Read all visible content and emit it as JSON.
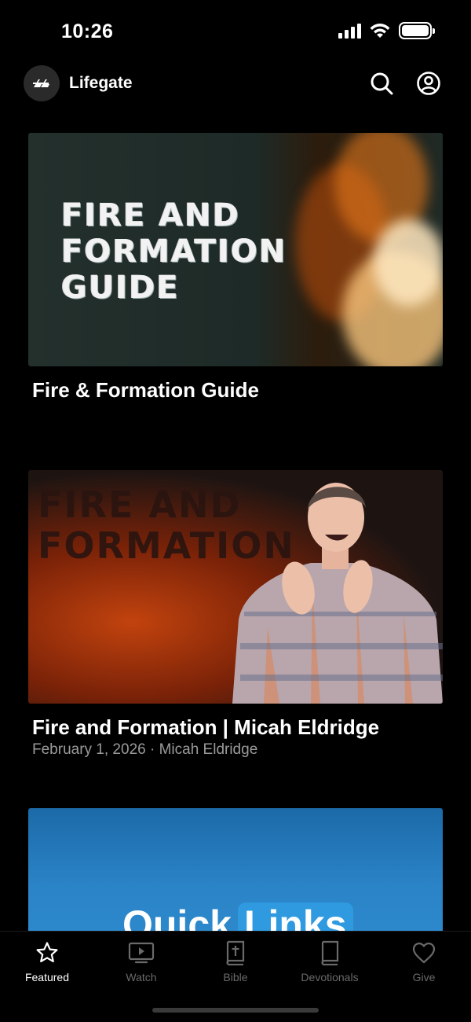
{
  "status_bar": {
    "time": "10:26"
  },
  "header": {
    "app_name": "Lifegate"
  },
  "cards": [
    {
      "thumbnail_text": [
        "FIRE AND",
        "FORMATION",
        "GUIDE"
      ],
      "title": "Fire & Formation Guide"
    },
    {
      "thumbnail_text": [
        "FIRE AND",
        "FORMATION"
      ],
      "title": "Fire and Formation | Micah Eldridge",
      "meta": "February 1, 2026 · Micah Eldridge"
    },
    {
      "thumbnail_text": [
        "Quick",
        "Links"
      ]
    }
  ],
  "tabs": [
    {
      "label": "Featured",
      "icon": "star-icon",
      "active": true
    },
    {
      "label": "Watch",
      "icon": "tv-icon"
    },
    {
      "label": "Bible",
      "icon": "bible-icon"
    },
    {
      "label": "Devotionals",
      "icon": "book-icon"
    },
    {
      "label": "Give",
      "icon": "heart-icon"
    }
  ],
  "colors": {
    "background": "#000000",
    "inactive_tab": "#6a6a6a",
    "meta_text": "#9a9a9a",
    "quick_links_blue": "#2d89cc"
  }
}
